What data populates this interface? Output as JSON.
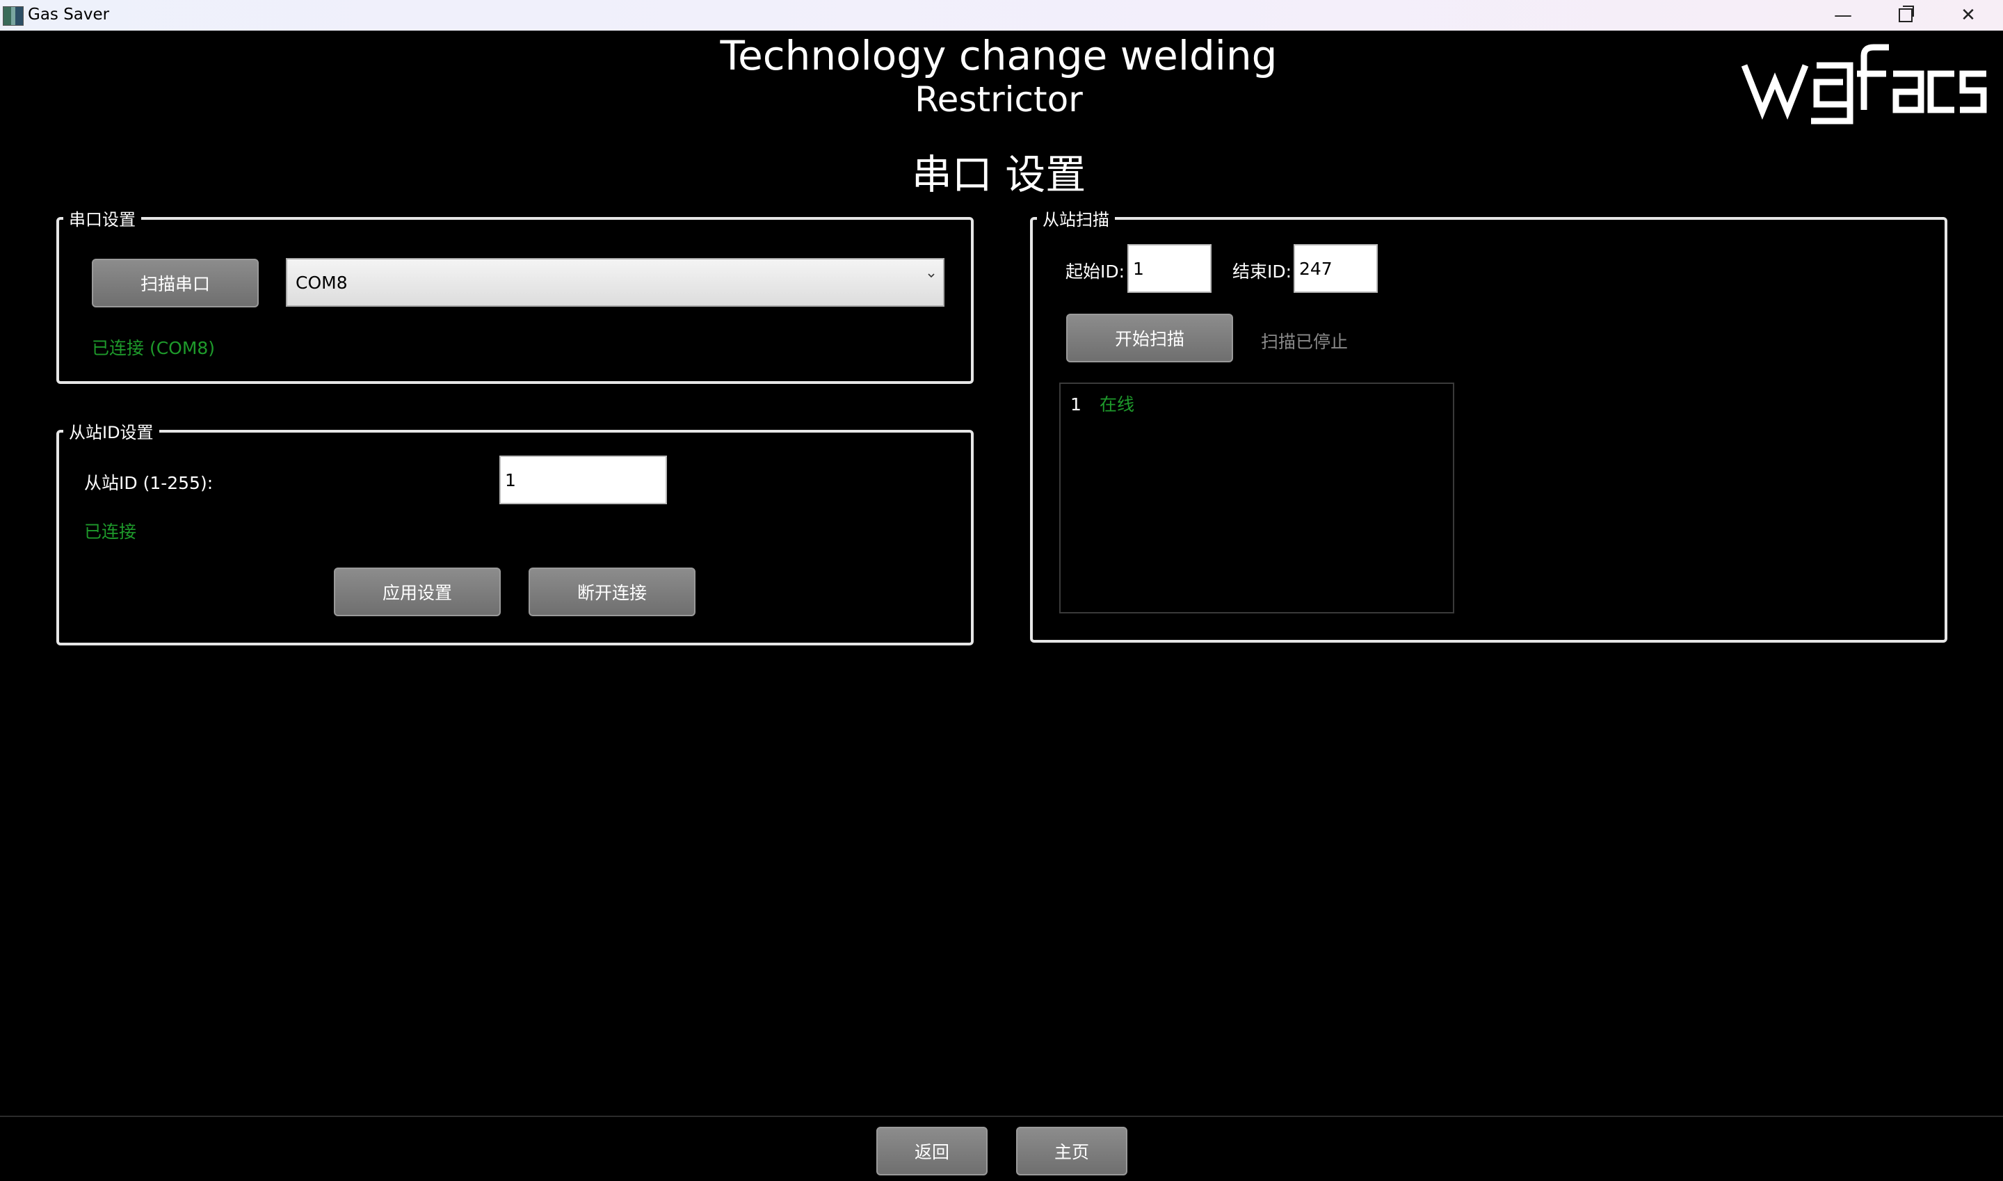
{
  "window": {
    "title": "Gas Saver",
    "minimize_glyph": "—",
    "close_glyph": "✕"
  },
  "header": {
    "title_line1": "Technology change welding",
    "title_line2": "Restrictor",
    "page_heading": "串口 设置",
    "logo_text": "wgfacs"
  },
  "serial_group": {
    "title": "串口设置",
    "scan_button": "扫描串口",
    "selected_port": "COM8",
    "status": "已连接 (COM8)"
  },
  "slave_group": {
    "title": "从站ID设置",
    "id_label": "从站ID (1-255):",
    "id_value": "1",
    "status": "已连接",
    "apply_button": "应用设置",
    "disconnect_button": "断开连接"
  },
  "scan_group": {
    "title": "从站扫描",
    "start_id_label": "起始ID:",
    "start_id_value": "1",
    "end_id_label": "结束ID:",
    "end_id_value": "247",
    "start_button": "开始扫描",
    "scan_status": "扫描已停止",
    "results": [
      {
        "id": "1",
        "state": "在线"
      }
    ]
  },
  "footer": {
    "back_button": "返回",
    "home_button": "主页"
  },
  "colors": {
    "background": "#000000",
    "status_green": "#1e9a2b",
    "button_gray": "#7a7a7a",
    "frame": "#e6e6e6"
  }
}
